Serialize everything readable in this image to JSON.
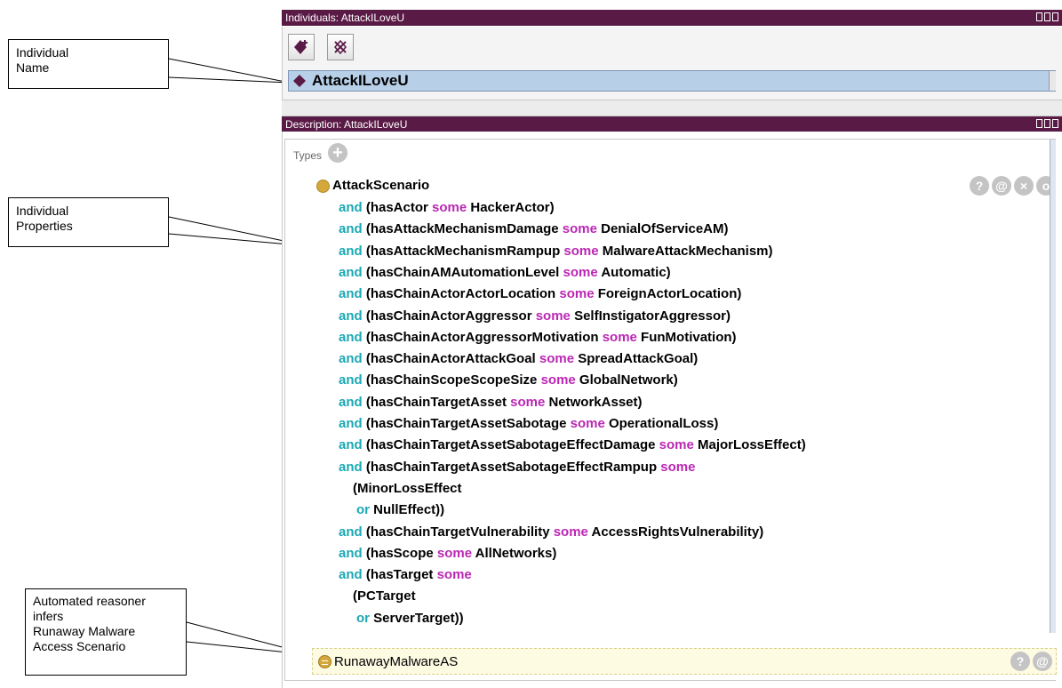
{
  "callouts": {
    "individual_name": [
      "Individual",
      "Name"
    ],
    "individual_properties": [
      "Individual",
      "Properties"
    ],
    "reasoner": [
      "Automated reasoner",
      "infers",
      "Runaway Malware",
      "Access Scenario"
    ]
  },
  "individuals_panel": {
    "title": "Individuals: AttackILoveU"
  },
  "individual": {
    "name": "AttackILoveU"
  },
  "description_panel": {
    "title": "Description: AttackILoveU"
  },
  "types": {
    "label": "Types",
    "add_symbol": "+",
    "asserted_class": "AttackScenario",
    "action_symbols": [
      "?",
      "@",
      "×",
      "o"
    ],
    "expression_lines": [
      [
        [
          "and",
          "kw-and"
        ],
        [
          " (hasActor ",
          ""
        ],
        [
          "some",
          "kw-some"
        ],
        [
          " HackerActor)",
          ""
        ]
      ],
      [
        [
          "and",
          "kw-and"
        ],
        [
          " (hasAttackMechanismDamage ",
          ""
        ],
        [
          "some",
          "kw-some"
        ],
        [
          " DenialOfServiceAM)",
          ""
        ]
      ],
      [
        [
          "and",
          "kw-and"
        ],
        [
          " (hasAttackMechanismRampup ",
          ""
        ],
        [
          "some",
          "kw-some"
        ],
        [
          " MalwareAttackMechanism)",
          ""
        ]
      ],
      [
        [
          "and",
          "kw-and"
        ],
        [
          " (hasChainAMAutomationLevel ",
          ""
        ],
        [
          "some",
          "kw-some"
        ],
        [
          " Automatic)",
          ""
        ]
      ],
      [
        [
          "and",
          "kw-and"
        ],
        [
          " (hasChainActorActorLocation ",
          ""
        ],
        [
          "some",
          "kw-some"
        ],
        [
          " ForeignActorLocation)",
          ""
        ]
      ],
      [
        [
          "and",
          "kw-and"
        ],
        [
          " (hasChainActorAggressor ",
          ""
        ],
        [
          "some",
          "kw-some"
        ],
        [
          " SelfInstigatorAggressor)",
          ""
        ]
      ],
      [
        [
          "and",
          "kw-and"
        ],
        [
          " (hasChainActorAggressorMotivation ",
          ""
        ],
        [
          "some",
          "kw-some"
        ],
        [
          " FunMotivation)",
          ""
        ]
      ],
      [
        [
          "and",
          "kw-and"
        ],
        [
          " (hasChainActorAttackGoal ",
          ""
        ],
        [
          "some",
          "kw-some"
        ],
        [
          " SpreadAttackGoal)",
          ""
        ]
      ],
      [
        [
          "and",
          "kw-and"
        ],
        [
          " (hasChainScopeScopeSize ",
          ""
        ],
        [
          "some",
          "kw-some"
        ],
        [
          " GlobalNetwork)",
          ""
        ]
      ],
      [
        [
          "and",
          "kw-and"
        ],
        [
          " (hasChainTargetAsset ",
          ""
        ],
        [
          "some",
          "kw-some"
        ],
        [
          " NetworkAsset)",
          ""
        ]
      ],
      [
        [
          "and",
          "kw-and"
        ],
        [
          " (hasChainTargetAssetSabotage ",
          ""
        ],
        [
          "some",
          "kw-some"
        ],
        [
          " OperationalLoss)",
          ""
        ]
      ],
      [
        [
          "and",
          "kw-and"
        ],
        [
          " (hasChainTargetAssetSabotageEffectDamage ",
          ""
        ],
        [
          "some",
          "kw-some"
        ],
        [
          " MajorLossEffect)",
          ""
        ]
      ],
      [
        [
          "and",
          "kw-and"
        ],
        [
          " (hasChainTargetAssetSabotageEffectRampup ",
          ""
        ],
        [
          "some",
          "kw-some"
        ]
      ],
      [
        [
          "(MinorLossEffect",
          ""
        ]
      ],
      [
        [
          "or",
          "kw-or"
        ],
        [
          " NullEffect))",
          ""
        ]
      ],
      [
        [
          "and",
          "kw-and"
        ],
        [
          " (hasChainTargetVulnerability ",
          ""
        ],
        [
          "some",
          "kw-some"
        ],
        [
          " AccessRightsVulnerability)",
          ""
        ]
      ],
      [
        [
          "and",
          "kw-and"
        ],
        [
          " (hasScope ",
          ""
        ],
        [
          "some",
          "kw-some"
        ],
        [
          " AllNetworks)",
          ""
        ]
      ],
      [
        [
          "and",
          "kw-and"
        ],
        [
          " (hasTarget ",
          ""
        ],
        [
          "some",
          "kw-some"
        ]
      ],
      [
        [
          "(PCTarget",
          ""
        ]
      ],
      [
        [
          "or",
          "kw-or"
        ],
        [
          " ServerTarget))",
          ""
        ]
      ]
    ],
    "inferred_class": "RunawayMalwareAS",
    "inferred_action_symbols": [
      "?",
      "@"
    ]
  }
}
